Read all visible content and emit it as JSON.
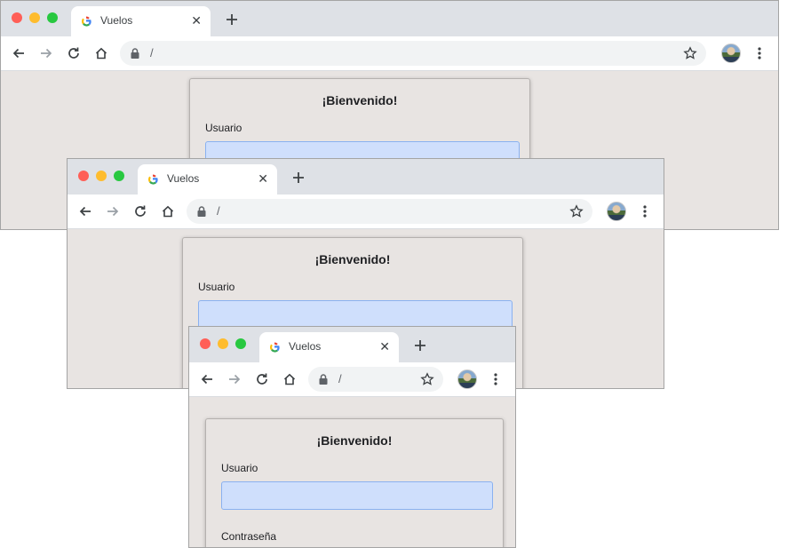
{
  "browser": {
    "tab_title": "Vuelos",
    "tab_close": "✕",
    "url": "/"
  },
  "login": {
    "title": "¡Bienvenido!",
    "user_label": "Usuario",
    "password_label": "Contraseña",
    "user_value": ""
  },
  "colors": {
    "page_bg": "#e8e4e2",
    "field_bg": "#cfdffc",
    "tabstrip": "#dee1e6"
  }
}
